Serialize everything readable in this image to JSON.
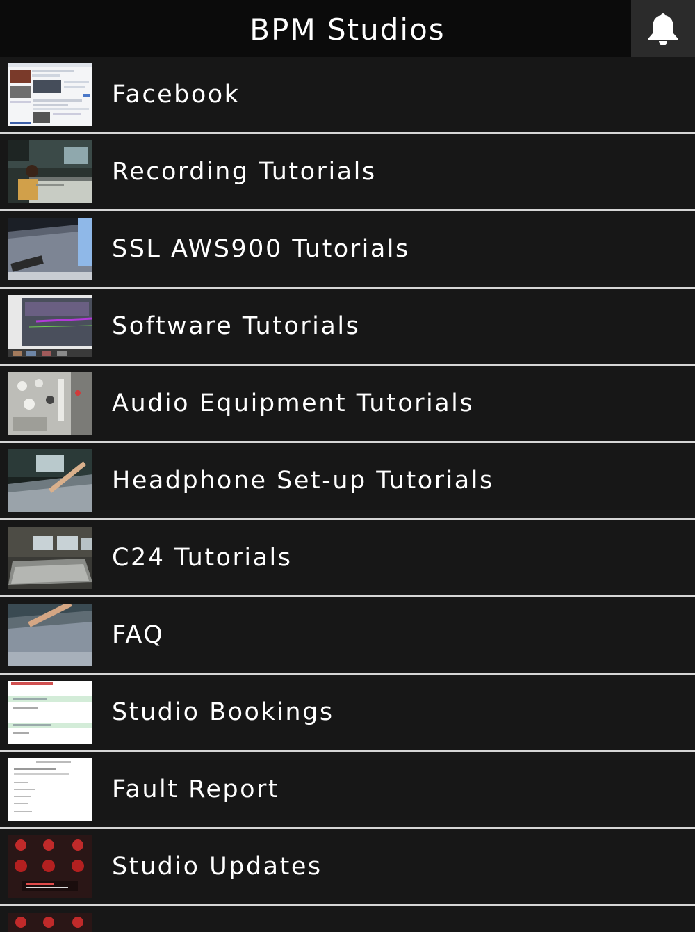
{
  "header": {
    "title": "BPM Studios",
    "bell_icon": "bell-icon"
  },
  "menu": {
    "items": [
      {
        "label": "Facebook",
        "thumb": "facebook-thumbnail"
      },
      {
        "label": "Recording Tutorials",
        "thumb": "recording-thumbnail"
      },
      {
        "label": "SSL AWS900 Tutorials",
        "thumb": "ssl-console-thumbnail"
      },
      {
        "label": "Software Tutorials",
        "thumb": "software-thumbnail"
      },
      {
        "label": "Audio Equipment Tutorials",
        "thumb": "audio-equipment-thumbnail"
      },
      {
        "label": "Headphone Set-up Tutorials",
        "thumb": "headphone-thumbnail"
      },
      {
        "label": "C24 Tutorials",
        "thumb": "c24-thumbnail"
      },
      {
        "label": "FAQ",
        "thumb": "faq-thumbnail"
      },
      {
        "label": "Studio Bookings",
        "thumb": "bookings-thumbnail"
      },
      {
        "label": "Fault Report",
        "thumb": "fault-report-thumbnail"
      },
      {
        "label": "Studio Updates",
        "thumb": "updates-thumbnail"
      }
    ]
  },
  "colors": {
    "background": "#171717",
    "header": "#0b0b0b",
    "divider": "#d6d6d6",
    "text": "#ffffff"
  }
}
